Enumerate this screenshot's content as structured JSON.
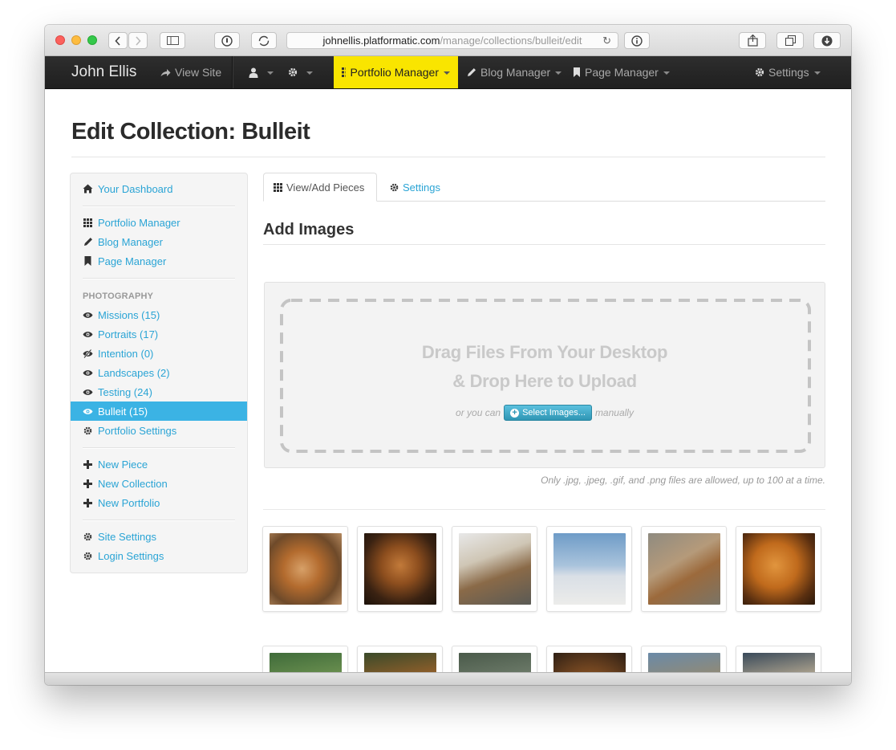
{
  "browser": {
    "url_host": "johnellis.platformatic.com",
    "url_path": "/manage/collections/bulleit/edit"
  },
  "navbar": {
    "brand": "John Ellis",
    "view_site": "View Site",
    "portfolio_manager": "Portfolio Manager",
    "blog_manager": "Blog Manager",
    "page_manager": "Page Manager",
    "settings": "Settings",
    "active_color": "#f9e500"
  },
  "page": {
    "title": "Edit Collection: Bulleit"
  },
  "sidebar": {
    "dashboard": "Your Dashboard",
    "managers": [
      "Portfolio Manager",
      "Blog Manager",
      "Page Manager"
    ],
    "section_header": "PHOTOGRAPHY",
    "collections": [
      {
        "label": "Missions (15)",
        "icon": "eye-icon"
      },
      {
        "label": "Portraits (17)",
        "icon": "eye-icon"
      },
      {
        "label": "Intention (0)",
        "icon": "eye-slash-icon"
      },
      {
        "label": "Landscapes (2)",
        "icon": "eye-icon"
      },
      {
        "label": "Testing (24)",
        "icon": "eye-icon"
      },
      {
        "label": "Bulleit (15)",
        "icon": "eye-icon",
        "active": true
      },
      {
        "label": "Portfolio Settings",
        "icon": "gear-icon"
      }
    ],
    "actions": [
      "New Piece",
      "New Collection",
      "New Portfolio"
    ],
    "settings": [
      "Site Settings",
      "Login Settings"
    ],
    "active_color": "#3bb3e4"
  },
  "tabs": {
    "view_add": "View/Add Pieces",
    "settings": "Settings"
  },
  "upload": {
    "heading": "Add Images",
    "drop_line1": "Drag Files From Your Desktop",
    "drop_line2": "& Drop Here to Upload",
    "or_you_can": "or you can",
    "select_button": "Select Images...",
    "manually": "manually",
    "note": "Only .jpg, .jpeg, .gif, and .png files are allowed, up to 100 at a time."
  },
  "thumbnails": {
    "row1_count": 6,
    "row2_count": 6
  }
}
